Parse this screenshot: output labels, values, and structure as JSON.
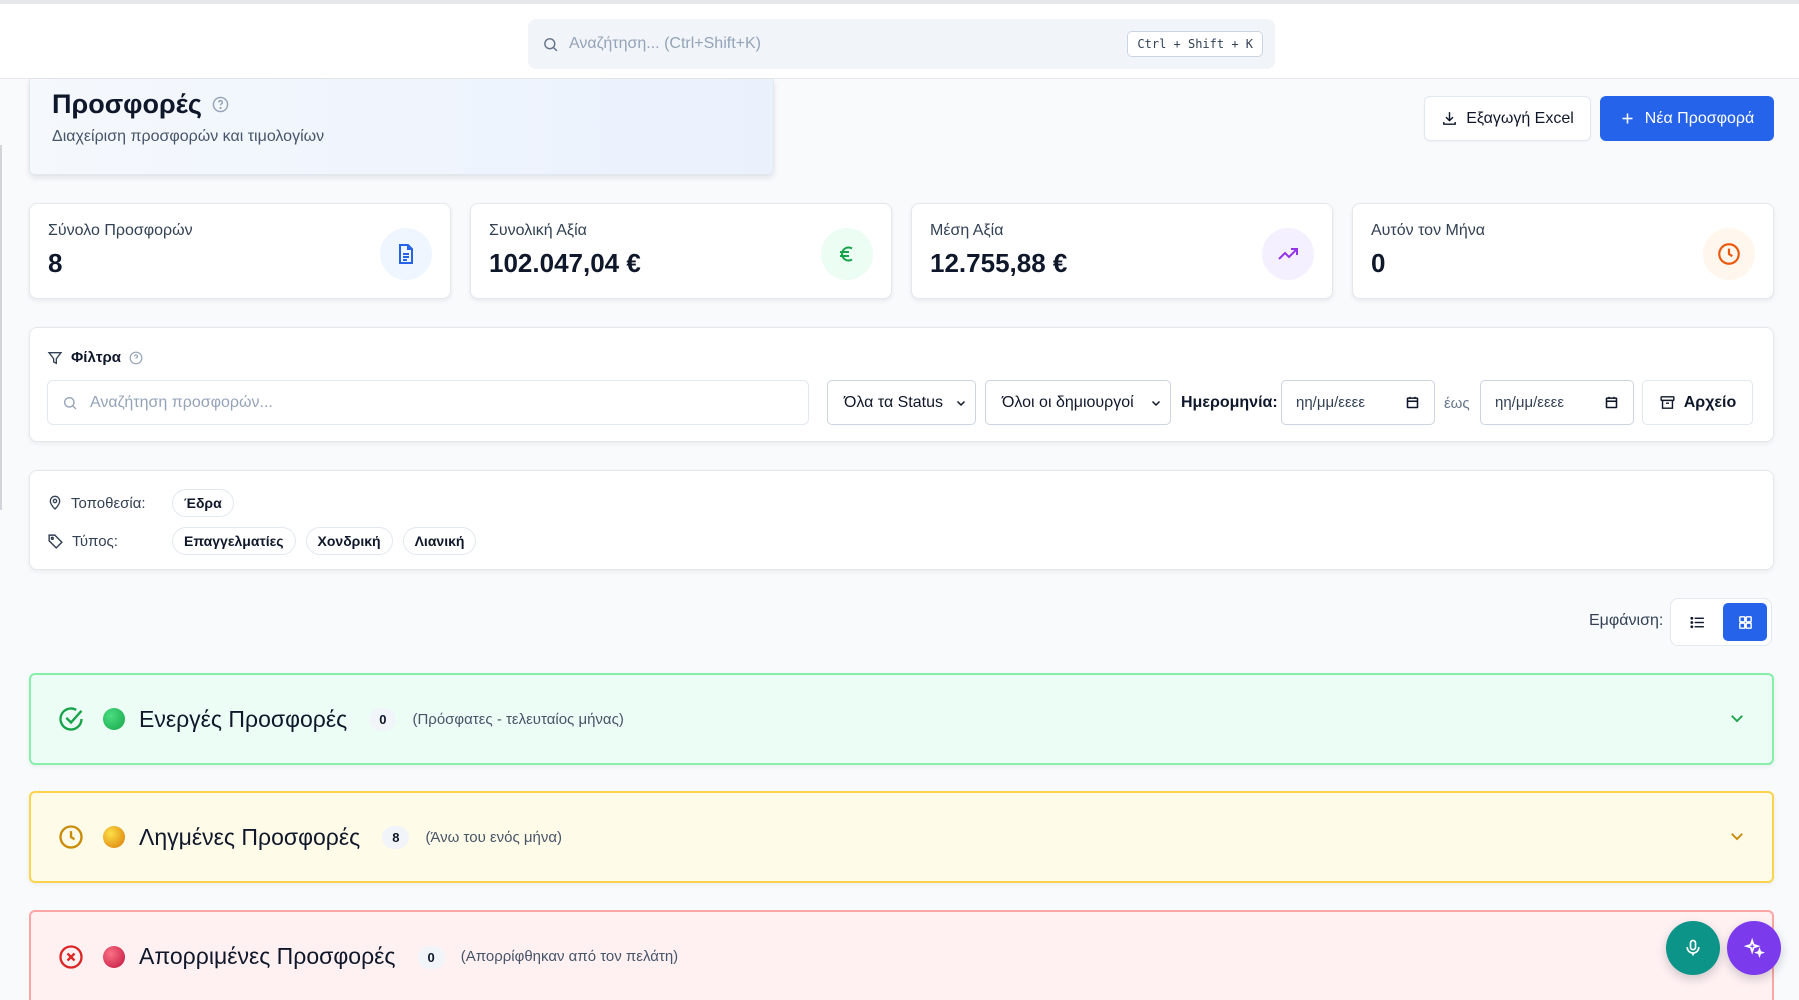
{
  "search": {
    "placeholder": "Αναζήτηση... (Ctrl+Shift+K)",
    "shortcut": "Ctrl + Shift + K"
  },
  "header": {
    "title": "Προσφορές",
    "subtitle": "Διαχείριση προσφορών και τιμολογίων"
  },
  "actions": {
    "export_label": "Εξαγωγή Excel",
    "new_label": "Νέα Προσφορά"
  },
  "stats": [
    {
      "label": "Σύνολο Προσφορών",
      "value": "8",
      "icon": "document-icon",
      "color": "#2563eb",
      "bg": "#eff6ff"
    },
    {
      "label": "Συνολική Αξία",
      "value": "102.047,04 €",
      "icon": "euro-icon",
      "color": "#16a34a",
      "bg": "#ecfdf3"
    },
    {
      "label": "Μέση Αξία",
      "value": "12.755,88 €",
      "icon": "trending-up-icon",
      "color": "#9333ea",
      "bg": "#f5f0ff"
    },
    {
      "label": "Αυτόν τον Μήνα",
      "value": "0",
      "icon": "clock-icon",
      "color": "#ea580c",
      "bg": "#fff7ed"
    }
  ],
  "filters": {
    "title": "Φίλτρα",
    "search_placeholder": "Αναζήτηση προσφορών...",
    "status_selected": "Όλα τα Status",
    "creator_selected": "Όλοι οι δημιουργοί",
    "date_label": "Ημερομηνία:",
    "date_from_placeholder": "ηη/μμ/εεεε",
    "date_to_label": "έως",
    "date_to_placeholder": "ηη/μμ/εεεε",
    "archive_label": "Αρχείο"
  },
  "tags": {
    "location_label": "Τοποθεσία:",
    "location_values": [
      "Έδρα"
    ],
    "type_label": "Τύπος:",
    "type_values": [
      "Επαγγελματίες",
      "Χονδρική",
      "Λιανική"
    ]
  },
  "view": {
    "label": "Εμφάνιση:",
    "modes": [
      "list",
      "grid"
    ],
    "active": "grid"
  },
  "sections": [
    {
      "title": "Ενεργές Προσφορές",
      "count": "0",
      "desc": "(Πρόσφατες - τελευταίος μήνας)",
      "color": "#16a34a",
      "dot": "#22c55e"
    },
    {
      "title": "Ληγμένες Προσφορές",
      "count": "8",
      "desc": "(Άνω του ενός μήνα)",
      "color": "#ca8a04",
      "dot": "#eab308"
    },
    {
      "title": "Απορριμένες Προσφορές",
      "count": "0",
      "desc": "(Απορρίφθηκαν από τον πελάτη)",
      "color": "#dc2626",
      "dot": "#e11d48"
    }
  ],
  "colors": {
    "primary": "#2563eb",
    "mic_fab": "#0d9488",
    "ai_fab": "#7c3aed"
  }
}
